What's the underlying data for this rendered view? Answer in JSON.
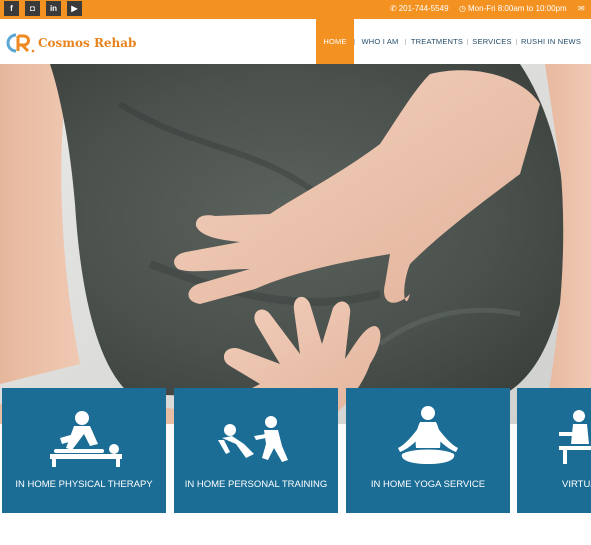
{
  "topbar": {
    "social": [
      {
        "name": "facebook",
        "glyph": "f"
      },
      {
        "name": "instagram",
        "glyph": "◘"
      },
      {
        "name": "linkedin",
        "glyph": "in"
      },
      {
        "name": "youtube",
        "glyph": "▶"
      }
    ],
    "phone": "201-744-5549",
    "hours": "Mon-Fri 8:00am to 10:00pm",
    "phone_icon": "phone-icon",
    "clock_icon": "clock-icon",
    "mail_icon": "mail-icon"
  },
  "header": {
    "brand": "Cosmos Rehab",
    "nav": [
      {
        "label": "HOME",
        "active": true
      },
      {
        "label": "WHO I AM"
      },
      {
        "label": "TREATMENTS"
      },
      {
        "label": "SERVICES"
      },
      {
        "label": "RUSHI IN NEWS"
      }
    ]
  },
  "colors": {
    "accent": "#f39221",
    "card": "#1b6d95",
    "nav_text": "#244c6a"
  },
  "services": [
    {
      "title": "IN HOME PHYSICAL THERAPY",
      "icon": "massage-therapy-icon"
    },
    {
      "title": "IN HOME PERSONAL TRAINING",
      "icon": "personal-training-icon"
    },
    {
      "title": "IN HOME YOGA SERVICE",
      "icon": "yoga-icon"
    },
    {
      "title": "VIRTUA",
      "icon": "virtual-session-icon"
    }
  ]
}
